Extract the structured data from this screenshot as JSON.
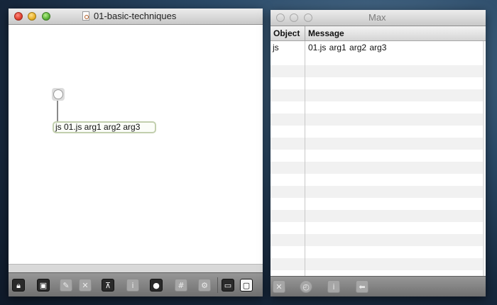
{
  "patcher_window": {
    "title": "01-basic-techniques",
    "js_object_text": "js 01.js arg1 arg2 arg3",
    "toolbar": [
      {
        "icon": "lock-icon",
        "glyph": "🔒︎",
        "label": ""
      },
      {
        "icon": "presentation-icon",
        "glyph": "▣",
        "label": ""
      },
      {
        "icon": "paint-icon",
        "glyph": "✎",
        "label": ""
      },
      {
        "icon": "close-box-icon",
        "glyph": "✕",
        "label": ""
      },
      {
        "icon": "easel-icon",
        "glyph": "⊼",
        "label": ""
      },
      {
        "icon": "info-icon",
        "glyph": "i",
        "label": ""
      },
      {
        "icon": "connect-icon",
        "glyph": "●",
        "label": ""
      },
      {
        "icon": "grid-icon",
        "glyph": "#",
        "label": ""
      },
      {
        "icon": "gear-icon",
        "glyph": "⚙",
        "label": ""
      },
      {
        "icon": "dock-bottom-icon",
        "glyph": "▭",
        "label": ""
      },
      {
        "icon": "dock-white-icon",
        "glyph": "▢",
        "label": ""
      }
    ]
  },
  "console_window": {
    "title": "Max",
    "columns": [
      "Object",
      "Message"
    ],
    "rows": [
      {
        "object": "js",
        "message": "01.js  arg1  arg2  arg3"
      }
    ],
    "toolbar": [
      {
        "icon": "clear-icon",
        "glyph": "✕"
      },
      {
        "icon": "clock-icon",
        "glyph": "◴"
      },
      {
        "icon": "info-icon",
        "glyph": "i"
      },
      {
        "icon": "back-arrow-icon",
        "glyph": "⬅"
      }
    ]
  }
}
